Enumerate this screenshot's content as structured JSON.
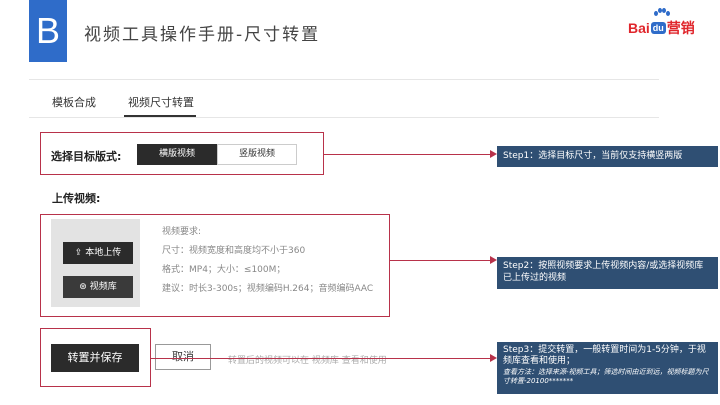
{
  "header": {
    "logo_letter": "B",
    "title": "视频工具操作手册-尺寸转置",
    "brand": {
      "bai": "Bai",
      "du": "du",
      "yingxiao": "营销"
    }
  },
  "tabs": [
    {
      "label": "模板合成",
      "active": false
    },
    {
      "label": "视频尺寸转置",
      "active": true
    }
  ],
  "format": {
    "label": "选择目标版式:",
    "options": [
      "横版视频",
      "竖版视频"
    ],
    "selected": "横版视频"
  },
  "upload": {
    "label": "上传视频:",
    "local_button": "本地上传",
    "library_button": "视频库",
    "requirements_title": "视频要求:",
    "requirements": [
      "尺寸：视频宽度和高度均不小于360",
      "格式：MP4；大小：≤100M；",
      "建议：时长3-300s；视频编码H.264；音频编码AAC"
    ]
  },
  "actions": {
    "save": "转置并保存",
    "cancel": "取消",
    "hint": "转置后的视频可以在 视频库 查看和使用"
  },
  "callouts": {
    "step1": "Step1：选择目标尺寸，当前仅支持横竖两版",
    "step2": "Step2：按照视频要求上传视频内容/或选择视频库已上传过的视频",
    "step3": "Step3：提交转置，一般转置时间为1-5分钟，于视频库查看和使用；",
    "step3_note": "查看方法：选择来源-视频工具；筛选时间由近到远，视频标题为尺寸转置-20100*******"
  },
  "colors": {
    "accent_blue": "#2f6cc9",
    "callout_bg": "#2f4f73",
    "highlight_red": "#b8324a",
    "button_dark": "#2b2b2b"
  }
}
